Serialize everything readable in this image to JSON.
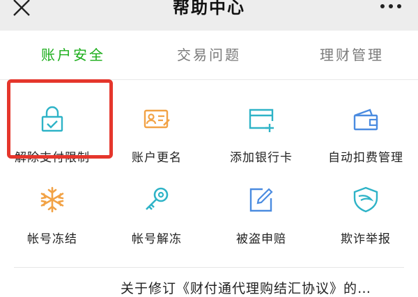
{
  "header": {
    "title": "帮助中心",
    "close_icon": "close-icon",
    "more_icon": "more-icon"
  },
  "tabs": [
    {
      "label": "账户安全",
      "active": true
    },
    {
      "label": "交易问题",
      "active": false
    },
    {
      "label": "理财管理",
      "active": false
    }
  ],
  "items": [
    {
      "label": "解除支付限制",
      "icon": "lock-check-icon",
      "color": "#2eb3c7"
    },
    {
      "label": "账户更名",
      "icon": "id-card-icon",
      "color": "#f2a245"
    },
    {
      "label": "添加银行卡",
      "icon": "add-card-icon",
      "color": "#2eb3c7"
    },
    {
      "label": "自动扣费管理",
      "icon": "wallet-icon",
      "color": "#4a8be0"
    },
    {
      "label": "帐号冻结",
      "icon": "snowflake-icon",
      "color": "#f2a245"
    },
    {
      "label": "帐号解冻",
      "icon": "key-icon",
      "color": "#2eb3c7"
    },
    {
      "label": "被盗申赔",
      "icon": "edit-note-icon",
      "color": "#4a8be0"
    },
    {
      "label": "欺诈举报",
      "icon": "shield-icon",
      "color": "#2eb3c7"
    }
  ],
  "notice": {
    "text": "关于修订《财付通代理购结汇协议》的…"
  },
  "colors": {
    "accent": "#1aad19",
    "highlight": "#e5362c"
  }
}
